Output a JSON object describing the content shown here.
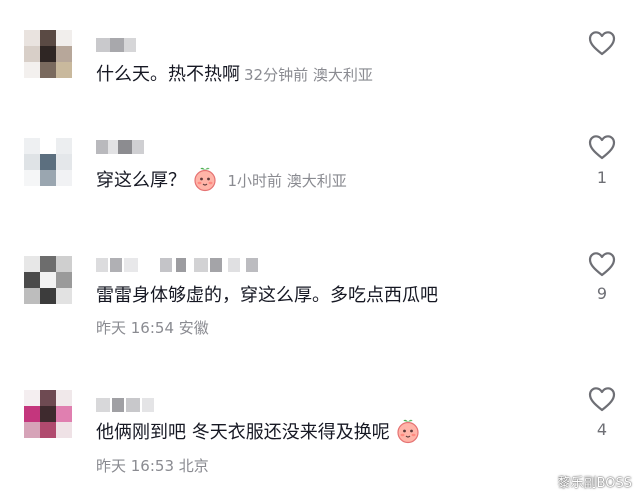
{
  "comments": [
    {
      "text": "什么天。热不热啊",
      "time": "32分钟前",
      "location": "澳大利亚",
      "likes": ""
    },
    {
      "text": "穿这么厚？",
      "emoji": "peach-face-emoji",
      "time": "1小时前",
      "location": "澳大利亚",
      "likes": "1"
    },
    {
      "text": "雷雷身体够虚的，穿这么厚。多吃点西瓜吧",
      "time": "昨天 16:54",
      "location": "安徽",
      "likes": "9"
    },
    {
      "text": "他俩刚到吧 冬天衣服还没来得及换呢",
      "emoji": "peach-face-emoji",
      "time": "昨天 16:53",
      "location": "北京",
      "likes": "4"
    }
  ],
  "watermark": {
    "text": "黎乐副BOSS",
    "icon": "weibo-icon"
  },
  "colors": {
    "text_primary": "#161823",
    "text_secondary": "#8a8b91",
    "heart_stroke": "#6e6f75"
  }
}
